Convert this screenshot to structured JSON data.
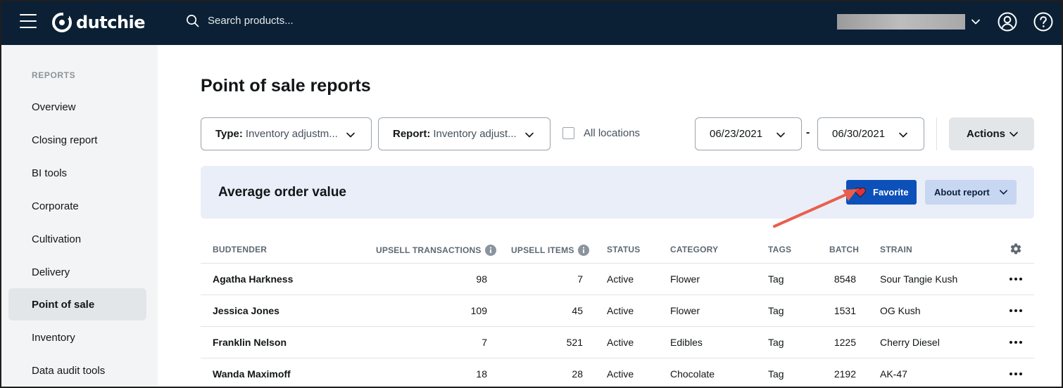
{
  "topbar": {
    "brand": "dutchie",
    "search_placeholder": "Search products...",
    "location_value": "",
    "icons": [
      "menu-icon",
      "search-icon",
      "chevron-down-icon",
      "user-icon",
      "help-icon"
    ]
  },
  "sidebar": {
    "heading": "REPORTS",
    "items": [
      {
        "label": "Overview"
      },
      {
        "label": "Closing report"
      },
      {
        "label": "BI tools"
      },
      {
        "label": "Corporate"
      },
      {
        "label": "Cultivation"
      },
      {
        "label": "Delivery"
      },
      {
        "label": "Point of sale",
        "active": true
      },
      {
        "label": "Inventory"
      },
      {
        "label": "Data audit tools"
      }
    ]
  },
  "main": {
    "title": "Point of sale reports",
    "type_filter": {
      "label": "Type:",
      "value": "Inventory adjustm..."
    },
    "report_filter": {
      "label": "Report:",
      "value": "Inventory adjust..."
    },
    "all_locations_label": "All locations",
    "date_start": "06/23/2021",
    "date_separator": "-",
    "date_end": "06/30/2021",
    "actions_label": "Actions"
  },
  "report": {
    "title": "Average order value",
    "favorite_label": "Favorite",
    "about_label": "About report"
  },
  "colors": {
    "topbar_bg": "#0b2035",
    "favorite_bg": "#0d50b9",
    "heart": "#e0323c",
    "arrow": "#e8604c"
  },
  "table": {
    "headers": {
      "budtender": "BUDTENDER",
      "upsell_transactions": "UPSELL TRANSACTIONS",
      "upsell_items": "UPSELL ITEMS",
      "status": "STATUS",
      "category": "CATEGORY",
      "tags": "TAGS",
      "batch": "BATCH",
      "strain": "STRAIN"
    },
    "rows": [
      {
        "budtender": "Agatha Harkness",
        "upsell_transactions": "98",
        "upsell_items": "7",
        "status": "Active",
        "category": "Flower",
        "tags": "Tag",
        "batch": "8548",
        "strain": "Sour Tangie Kush"
      },
      {
        "budtender": "Jessica Jones",
        "upsell_transactions": "109",
        "upsell_items": "45",
        "status": "Active",
        "category": "Flower",
        "tags": "Tag",
        "batch": "1531",
        "strain": "OG Kush"
      },
      {
        "budtender": "Franklin Nelson",
        "upsell_transactions": "7",
        "upsell_items": "521",
        "status": "Active",
        "category": "Edibles",
        "tags": "Tag",
        "batch": "1225",
        "strain": "Cherry Diesel"
      },
      {
        "budtender": "Wanda Maximoff",
        "upsell_transactions": "18",
        "upsell_items": "28",
        "status": "Active",
        "category": "Chocolate",
        "tags": "Tag",
        "batch": "2192",
        "strain": "AK-47"
      }
    ]
  }
}
